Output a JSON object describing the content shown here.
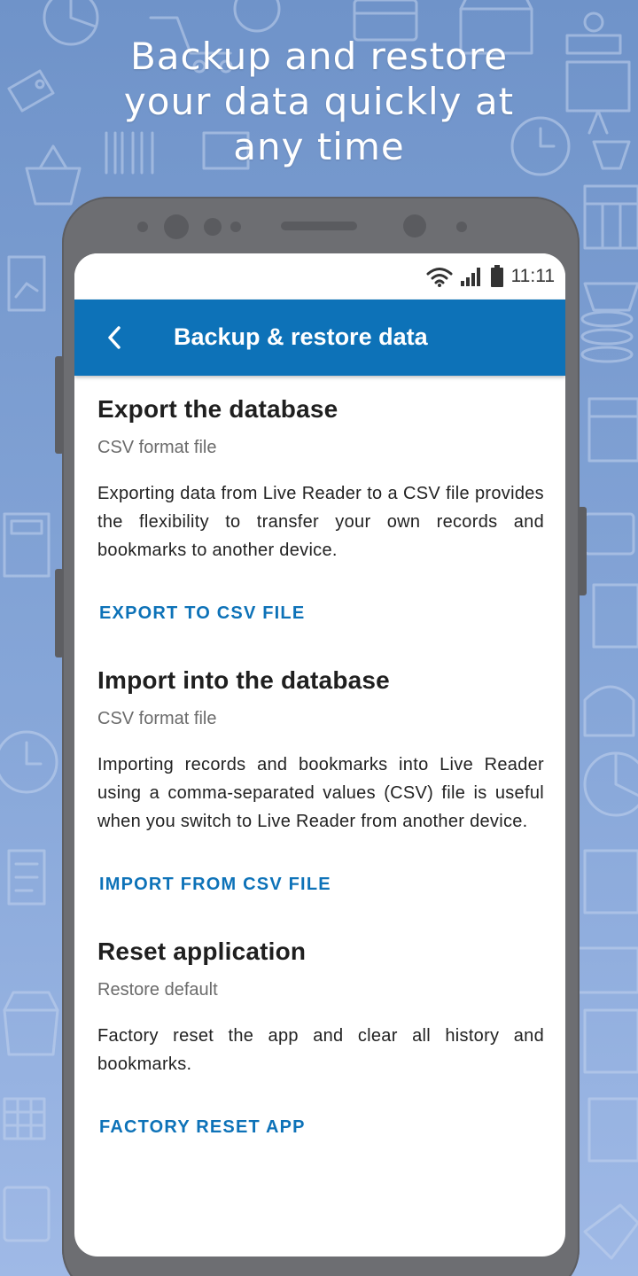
{
  "promo": {
    "headline_line1": "Backup and restore",
    "headline_line2": "your data quickly at",
    "headline_line3": "any time"
  },
  "status_bar": {
    "time": "11:11",
    "icons": [
      "wifi-icon",
      "signal-icon",
      "battery-icon"
    ]
  },
  "app_bar": {
    "title": "Backup & restore data",
    "back_icon": "chevron-left-icon",
    "color": "#0d72b8"
  },
  "sections": [
    {
      "title": "Export the database",
      "subtitle": "CSV format file",
      "body": "Exporting data from Live Reader to a CSV file provides the flexibility to transfer your own records and bookmarks to another device.",
      "action": "EXPORT TO CSV FILE"
    },
    {
      "title": "Import into the database",
      "subtitle": "CSV format file",
      "body": "Importing records and bookmarks into Live Reader using a comma-separated values (CSV) file is useful when you switch to Live Reader from another device.",
      "action": "IMPORT FROM CSV FILE"
    },
    {
      "title": "Reset application",
      "subtitle": "Restore default",
      "body": "Factory reset the app and clear all history and bookmarks.",
      "action": "FACTORY RESET APP"
    }
  ],
  "colors": {
    "accent": "#0d72b8",
    "background_top": "#6f93c9",
    "background_bottom": "#9fb9e6",
    "phone_frame": "#6d6e72"
  }
}
